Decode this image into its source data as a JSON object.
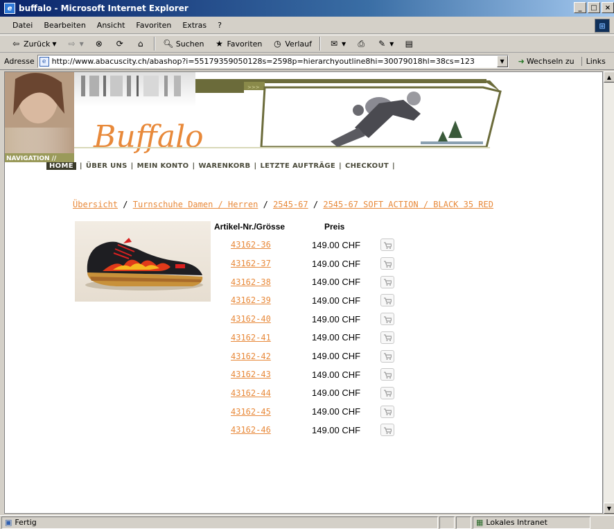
{
  "window": {
    "title": "buffalo - Microsoft Internet Explorer",
    "buttons": [
      "_",
      "□",
      "×"
    ]
  },
  "menu": [
    "Datei",
    "Bearbeiten",
    "Ansicht",
    "Favoriten",
    "Extras",
    "?"
  ],
  "toolbar": {
    "back": "Zurück",
    "search": "Suchen",
    "favorites": "Favoriten",
    "history": "Verlauf"
  },
  "address": {
    "label": "Adresse",
    "url": "http://www.abacuscity.ch/abashop?i=55179359050128s=2598p=hierarchyoutline8hi=30079018hl=38cs=123",
    "go": "Wechseln zu",
    "links": "Links"
  },
  "site": {
    "brand": "Buffalo",
    "nav_tag": "NAVIGATION //",
    "nav": [
      "HOME",
      "ÜBER UNS",
      "MEIN KONTO",
      "WARENKORB",
      "LETZTE AUFTRÄGE",
      "CHECKOUT"
    ],
    "crumbs": [
      "Übersicht",
      "Turnschuhe Damen / Herren",
      "2545-67",
      "2545-67 SOFT ACTION / BLACK 35 RED"
    ],
    "crumb_sep": "/",
    "table": {
      "col_article": "Artikel-Nr./Grösse",
      "col_price": "Preis",
      "rows": [
        {
          "article": "43162-36",
          "price": "149.00 CHF"
        },
        {
          "article": "43162-37",
          "price": "149.00 CHF"
        },
        {
          "article": "43162-38",
          "price": "149.00 CHF"
        },
        {
          "article": "43162-39",
          "price": "149.00 CHF"
        },
        {
          "article": "43162-40",
          "price": "149.00 CHF"
        },
        {
          "article": "43162-41",
          "price": "149.00 CHF"
        },
        {
          "article": "43162-42",
          "price": "149.00 CHF"
        },
        {
          "article": "43162-43",
          "price": "149.00 CHF"
        },
        {
          "article": "43162-44",
          "price": "149.00 CHF"
        },
        {
          "article": "43162-45",
          "price": "149.00 CHF"
        },
        {
          "article": "43162-46",
          "price": "149.00 CHF"
        }
      ]
    }
  },
  "status": {
    "text": "Fertig",
    "zone": "Lokales Intranet"
  },
  "colors": {
    "link": "#e8893a",
    "brand_olive": "#6b6b3a",
    "titlebar": "#0a246a"
  }
}
